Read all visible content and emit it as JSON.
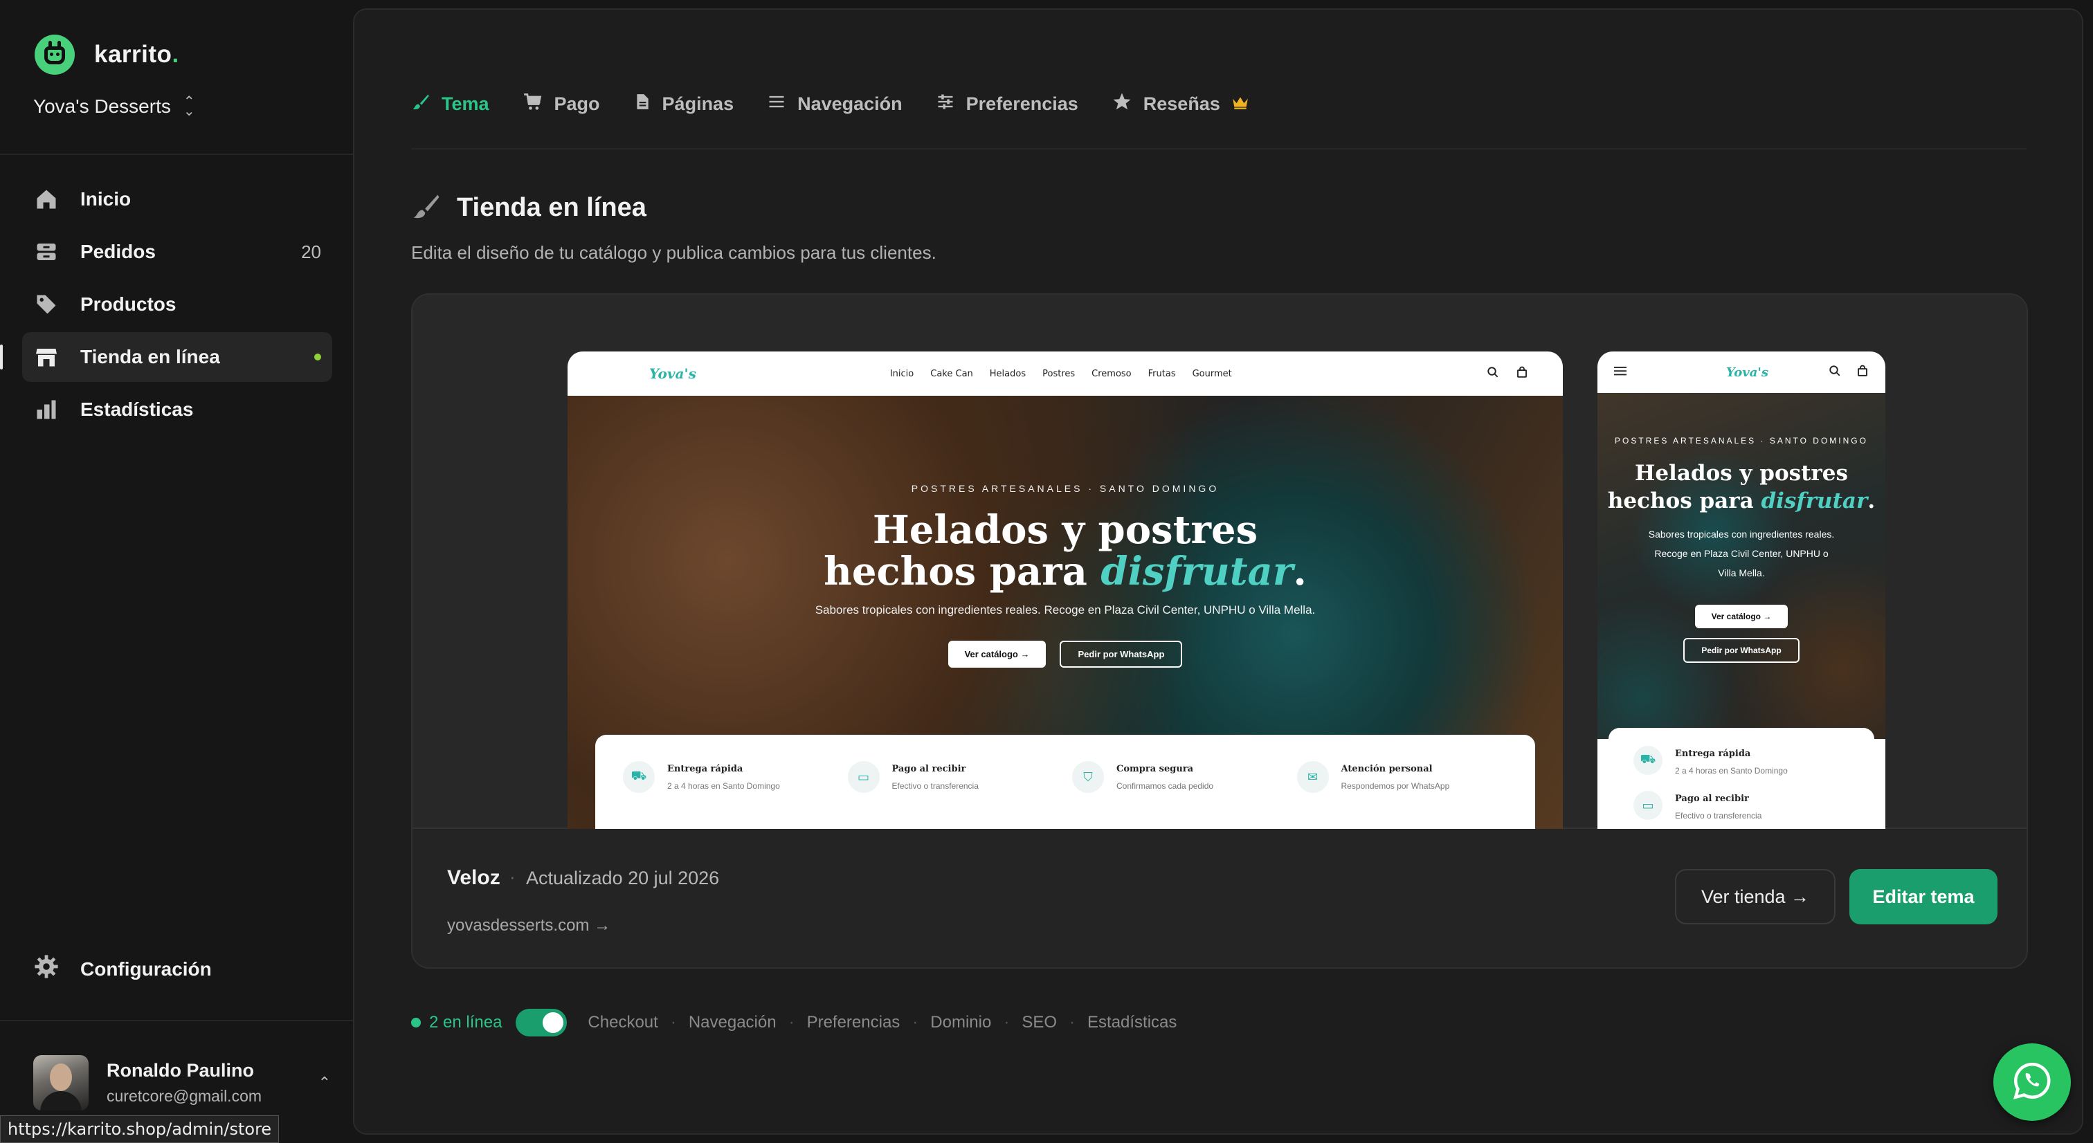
{
  "brand": {
    "name": "karrito",
    "dot": ".",
    "accent": "#49d07a"
  },
  "store": {
    "name": "Yova's Desserts"
  },
  "sidebar": {
    "items": [
      {
        "label": "Inicio",
        "icon": "home-icon"
      },
      {
        "label": "Pedidos",
        "icon": "inbox-icon",
        "count": "20"
      },
      {
        "label": "Productos",
        "icon": "tag-icon"
      },
      {
        "label": "Tienda en línea",
        "icon": "store-icon",
        "active": true
      },
      {
        "label": "Estadísticas",
        "icon": "bar-chart-icon"
      }
    ],
    "settings_label": "Configuración"
  },
  "user": {
    "name": "Ronaldo Paulino",
    "email": "curetcore@gmail.com"
  },
  "status_url": "https://karrito.shop/admin/store",
  "tabs": [
    {
      "label": "Tema",
      "icon": "brush-icon",
      "active": true
    },
    {
      "label": "Pago",
      "icon": "cart-icon"
    },
    {
      "label": "Páginas",
      "icon": "document-icon"
    },
    {
      "label": "Navegación",
      "icon": "menu-icon"
    },
    {
      "label": "Preferencias",
      "icon": "sliders-icon"
    },
    {
      "label": "Reseñas",
      "icon": "star-icon",
      "badge_icon": "crown-icon"
    }
  ],
  "page": {
    "title": "Tienda en línea",
    "subtitle": "Edita el diseño de tu catálogo y publica cambios para tus clientes."
  },
  "preview": {
    "logo": "Yova's",
    "nav_links": [
      "Inicio",
      "Cake Can",
      "Helados",
      "Postres",
      "Cremoso",
      "Frutas",
      "Gourmet"
    ],
    "eyebrow": "POSTRES ARTESANALES · SANTO DOMINGO",
    "title_line1": "Helados y postres",
    "title_line2": "hechos para",
    "title_accent": "disfrutar",
    "title_end": ".",
    "description": "Sabores tropicales con ingredientes reales. Recoge en Plaza Civil Center, UNPHU o Villa Mella.",
    "mobile_desc_1": "Sabores tropicales con ingredientes reales.",
    "mobile_desc_2": "Recoge en Plaza Civil Center, UNPHU o",
    "mobile_desc_3": "Villa Mella.",
    "btn_catalog": "Ver catálogo →",
    "btn_whatsapp": "Pedir por WhatsApp",
    "features": [
      {
        "title": "Entrega rápida",
        "sub": "2 a 4 horas en Santo Domingo"
      },
      {
        "title": "Pago al recibir",
        "sub": "Efectivo o transferencia"
      },
      {
        "title": "Compra segura",
        "sub": "Confirmamos cada pedido"
      },
      {
        "title": "Atención personal",
        "sub": "Respondemos por WhatsApp"
      }
    ]
  },
  "theme": {
    "name": "Veloz",
    "separator": "·",
    "updated": "Actualizado 20 jul 2026",
    "url": "yovasdesserts.com →",
    "view_label": "Ver tienda →",
    "edit_label": "Editar tema"
  },
  "footer": {
    "online_label": "2 en línea",
    "toggle_on": true,
    "links": [
      "Checkout",
      "Navegación",
      "Preferencias",
      "Dominio",
      "SEO",
      "Estadísticas"
    ]
  },
  "colors": {
    "primary": "#1a9e6e",
    "accent_text": "#2bc58a",
    "teal": "#4fd0c3",
    "whatsapp": "#29c462"
  }
}
